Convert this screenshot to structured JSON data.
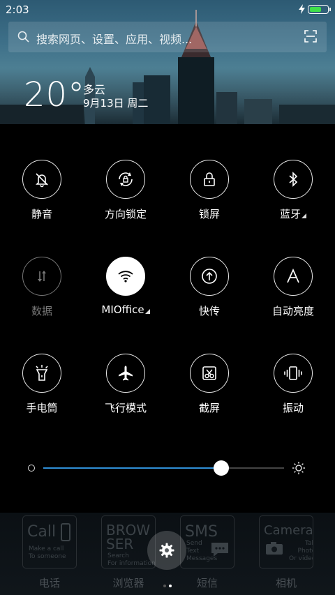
{
  "status_bar": {
    "time": "2:03",
    "battery_level": 0.65,
    "charging": true
  },
  "search": {
    "placeholder": "搜索网页、设置、应用、视频..."
  },
  "weather": {
    "temperature": "20°",
    "condition": "多云",
    "date": "9月13日 周二"
  },
  "toggles": [
    {
      "id": "mute",
      "label": "静音",
      "icon": "bell-off-icon",
      "state": "off"
    },
    {
      "id": "rotation-lock",
      "label": "方向锁定",
      "icon": "rotation-lock-icon",
      "state": "off"
    },
    {
      "id": "lock-screen",
      "label": "锁屏",
      "icon": "lock-icon",
      "state": "off"
    },
    {
      "id": "bluetooth",
      "label": "蓝牙",
      "icon": "bluetooth-icon",
      "state": "off",
      "expandable": true
    },
    {
      "id": "data",
      "label": "数据",
      "icon": "data-arrows-icon",
      "state": "disabled"
    },
    {
      "id": "wifi",
      "label": "MIOffice",
      "icon": "wifi-icon",
      "state": "on",
      "expandable": true
    },
    {
      "id": "quick-transfer",
      "label": "快传",
      "icon": "upload-icon",
      "state": "off"
    },
    {
      "id": "auto-brightness",
      "label": "自动亮度",
      "icon": "letter-a-icon",
      "state": "off"
    },
    {
      "id": "flashlight",
      "label": "手电筒",
      "icon": "flashlight-icon",
      "state": "off"
    },
    {
      "id": "airplane",
      "label": "飞行模式",
      "icon": "airplane-icon",
      "state": "off"
    },
    {
      "id": "screenshot",
      "label": "截屏",
      "icon": "scissors-icon",
      "state": "off"
    },
    {
      "id": "vibrate",
      "label": "振动",
      "icon": "vibrate-icon",
      "state": "off"
    }
  ],
  "brightness": {
    "level": 0.74
  },
  "dock": {
    "apps": [
      {
        "name": "电话",
        "tile_title": "Call",
        "tile_sub": "Make a call\nTo someone"
      },
      {
        "name": "浏览器",
        "tile_title": "BROW SER",
        "tile_sub": "Search\nFor information"
      },
      {
        "name": "短信",
        "tile_title": "SMS",
        "tile_sub": "Send\nText\nMessages"
      },
      {
        "name": "相机",
        "tile_title": "Camera",
        "tile_sub": "Take\nPhotos\nOr videos"
      }
    ]
  },
  "colors": {
    "accent": "#2f8fd6",
    "battery": "#3fe04a",
    "background": "#000000"
  }
}
